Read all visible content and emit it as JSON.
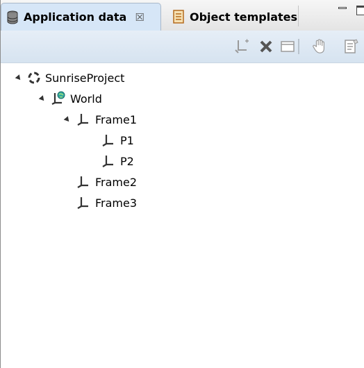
{
  "tabs": {
    "active": {
      "label": "Application data",
      "close": "☒"
    },
    "inactive": {
      "label": "Object templates"
    }
  },
  "toolbar": {
    "buttons": [
      "add-frame-icon",
      "delete-icon",
      "collapse-icon",
      "hand-icon",
      "properties-icon"
    ]
  },
  "tree": {
    "project": "SunriseProject",
    "world": "World",
    "frame1": "Frame1",
    "p1": "P1",
    "p2": "P2",
    "frame2": "Frame2",
    "frame3": "Frame3"
  },
  "colors": {
    "accent": "#d6e6f7",
    "world_globe": "#2fa6a0",
    "delete_red": "#333333"
  }
}
